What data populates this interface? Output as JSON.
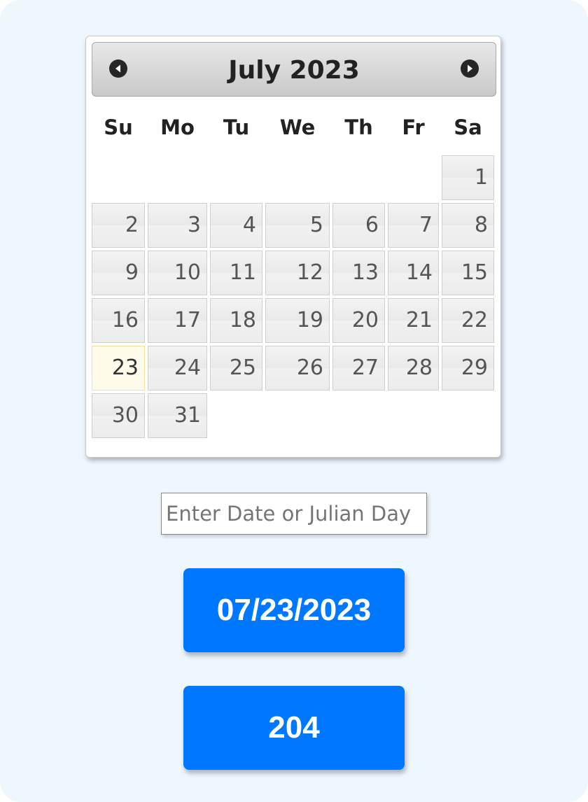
{
  "calendar": {
    "month_title": "July 2023",
    "prev_icon": "prev-arrow-icon",
    "next_icon": "next-arrow-icon",
    "weekdays": [
      "Su",
      "Mo",
      "Tu",
      "We",
      "Th",
      "Fr",
      "Sa"
    ],
    "weeks": [
      [
        "",
        "",
        "",
        "",
        "",
        "",
        "1"
      ],
      [
        "2",
        "3",
        "4",
        "5",
        "6",
        "7",
        "8"
      ],
      [
        "9",
        "10",
        "11",
        "12",
        "13",
        "14",
        "15"
      ],
      [
        "16",
        "17",
        "18",
        "19",
        "20",
        "21",
        "22"
      ],
      [
        "23",
        "24",
        "25",
        "26",
        "27",
        "28",
        "29"
      ],
      [
        "30",
        "31",
        "",
        "",
        "",
        "",
        ""
      ]
    ],
    "today": "23",
    "today_highlight_color": "#fffbea"
  },
  "input": {
    "placeholder": "Enter Date or Julian Day",
    "value": ""
  },
  "buttons": {
    "date_label": "07/23/2023",
    "julian_label": "204",
    "color": "#0077ff"
  }
}
